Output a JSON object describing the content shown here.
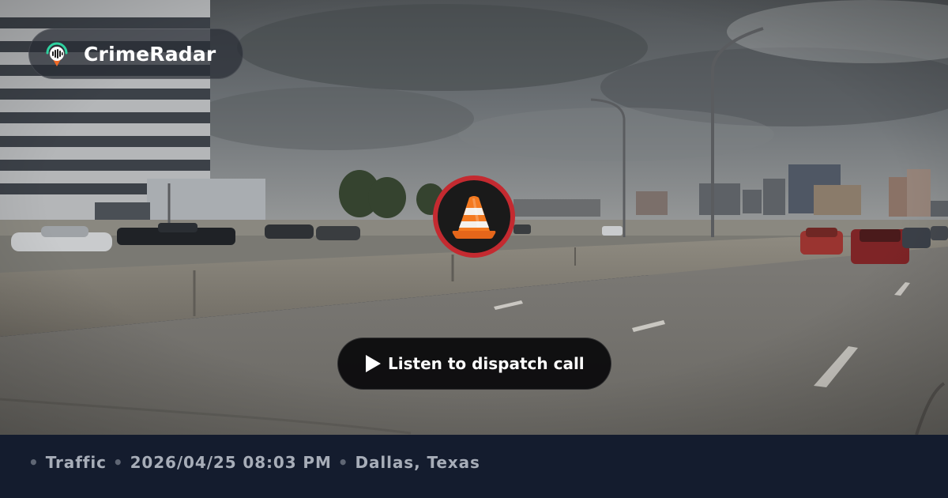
{
  "brand": {
    "name": "CrimeRadar",
    "logo_icon": "radar-pin-icon"
  },
  "incident": {
    "category_icon": "traffic-cone-icon",
    "category": "Traffic",
    "datetime": "2026/04/25 08:03 PM",
    "location": "Dallas, Texas"
  },
  "listen_button": {
    "label": "Listen to dispatch call",
    "icon": "play-icon"
  },
  "meta_separator": "•",
  "colors": {
    "footer_background": "#141c2e",
    "meta_text": "#a7adb8",
    "badge_ring": "#c42a30",
    "cone_orange": "#f47a20",
    "button_background": "#0a0a0c"
  }
}
